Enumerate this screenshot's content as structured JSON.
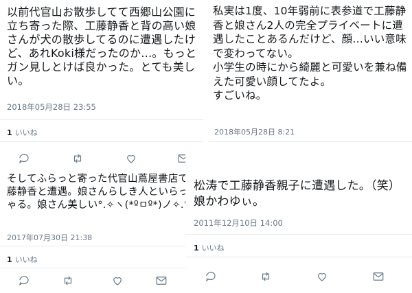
{
  "tweets": [
    {
      "text": "以前代官山お散歩してて西郷山公園に立ち寄った際、工藤静香と背の高い娘さんが犬の散歩してるのに遭遇したけど、あれKoki様だったのか…。もっとガン見しとけば良かった。とても美しい。",
      "timestamp": "2018年05月28日 23:55",
      "like_count": "1",
      "like_label": "いいね"
    },
    {
      "text": "私実は1度、10年弱前に表参道で工藤静香と娘さん2人の完全プライベートに遭遇したことあるんだけど、顔…いい意味で変わってない。\n小学生の時にから綺麗と可愛いを兼ね備えた可愛い顔してたよ。\nすごいね。",
      "timestamp": "2018年05月28日 8:21"
    },
    {
      "text": "そしてふらっと寄った代官山蔦屋書店で工藤静香と遭遇。娘さんらしき人といらっしゃる。娘さん美しい°.✧ヽ(*ºㅁº*)ノ✧.°",
      "timestamp": "2017年07月30日 21:38",
      "like_count": "1",
      "like_label": "いいね"
    },
    {
      "text": "松涛で工藤静香親子に遭遇した。（笑）娘かわゆぃ。",
      "timestamp": "2011年12月10日 14:00",
      "like_count": "1",
      "like_label": "いいね"
    }
  ],
  "icons": [
    "reply-icon",
    "retweet-icon",
    "like-icon",
    "message-icon"
  ],
  "colors": {
    "muted": "#657786",
    "divider": "#e6ecf0",
    "text": "#14171a"
  }
}
